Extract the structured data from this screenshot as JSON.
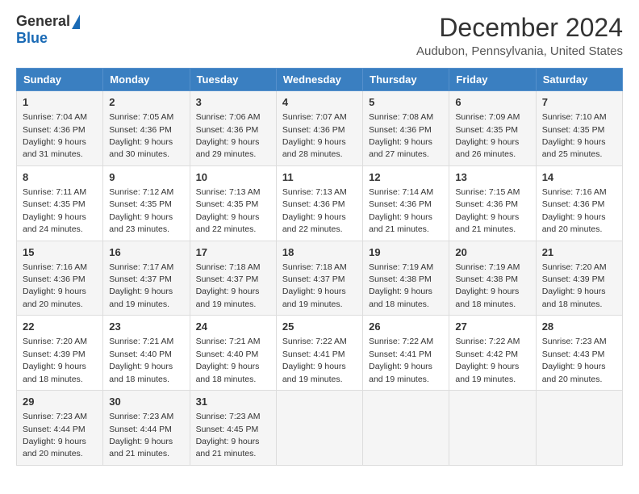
{
  "logo": {
    "general": "General",
    "blue": "Blue"
  },
  "title": "December 2024",
  "location": "Audubon, Pennsylvania, United States",
  "days_of_week": [
    "Sunday",
    "Monday",
    "Tuesday",
    "Wednesday",
    "Thursday",
    "Friday",
    "Saturday"
  ],
  "weeks": [
    [
      {
        "day": "1",
        "sunrise": "7:04 AM",
        "sunset": "4:36 PM",
        "daylight": "9 hours and 31 minutes."
      },
      {
        "day": "2",
        "sunrise": "7:05 AM",
        "sunset": "4:36 PM",
        "daylight": "9 hours and 30 minutes."
      },
      {
        "day": "3",
        "sunrise": "7:06 AM",
        "sunset": "4:36 PM",
        "daylight": "9 hours and 29 minutes."
      },
      {
        "day": "4",
        "sunrise": "7:07 AM",
        "sunset": "4:36 PM",
        "daylight": "9 hours and 28 minutes."
      },
      {
        "day": "5",
        "sunrise": "7:08 AM",
        "sunset": "4:36 PM",
        "daylight": "9 hours and 27 minutes."
      },
      {
        "day": "6",
        "sunrise": "7:09 AM",
        "sunset": "4:35 PM",
        "daylight": "9 hours and 26 minutes."
      },
      {
        "day": "7",
        "sunrise": "7:10 AM",
        "sunset": "4:35 PM",
        "daylight": "9 hours and 25 minutes."
      }
    ],
    [
      {
        "day": "8",
        "sunrise": "7:11 AM",
        "sunset": "4:35 PM",
        "daylight": "9 hours and 24 minutes."
      },
      {
        "day": "9",
        "sunrise": "7:12 AM",
        "sunset": "4:35 PM",
        "daylight": "9 hours and 23 minutes."
      },
      {
        "day": "10",
        "sunrise": "7:13 AM",
        "sunset": "4:35 PM",
        "daylight": "9 hours and 22 minutes."
      },
      {
        "day": "11",
        "sunrise": "7:13 AM",
        "sunset": "4:36 PM",
        "daylight": "9 hours and 22 minutes."
      },
      {
        "day": "12",
        "sunrise": "7:14 AM",
        "sunset": "4:36 PM",
        "daylight": "9 hours and 21 minutes."
      },
      {
        "day": "13",
        "sunrise": "7:15 AM",
        "sunset": "4:36 PM",
        "daylight": "9 hours and 21 minutes."
      },
      {
        "day": "14",
        "sunrise": "7:16 AM",
        "sunset": "4:36 PM",
        "daylight": "9 hours and 20 minutes."
      }
    ],
    [
      {
        "day": "15",
        "sunrise": "7:16 AM",
        "sunset": "4:36 PM",
        "daylight": "9 hours and 20 minutes."
      },
      {
        "day": "16",
        "sunrise": "7:17 AM",
        "sunset": "4:37 PM",
        "daylight": "9 hours and 19 minutes."
      },
      {
        "day": "17",
        "sunrise": "7:18 AM",
        "sunset": "4:37 PM",
        "daylight": "9 hours and 19 minutes."
      },
      {
        "day": "18",
        "sunrise": "7:18 AM",
        "sunset": "4:37 PM",
        "daylight": "9 hours and 19 minutes."
      },
      {
        "day": "19",
        "sunrise": "7:19 AM",
        "sunset": "4:38 PM",
        "daylight": "9 hours and 18 minutes."
      },
      {
        "day": "20",
        "sunrise": "7:19 AM",
        "sunset": "4:38 PM",
        "daylight": "9 hours and 18 minutes."
      },
      {
        "day": "21",
        "sunrise": "7:20 AM",
        "sunset": "4:39 PM",
        "daylight": "9 hours and 18 minutes."
      }
    ],
    [
      {
        "day": "22",
        "sunrise": "7:20 AM",
        "sunset": "4:39 PM",
        "daylight": "9 hours and 18 minutes."
      },
      {
        "day": "23",
        "sunrise": "7:21 AM",
        "sunset": "4:40 PM",
        "daylight": "9 hours and 18 minutes."
      },
      {
        "day": "24",
        "sunrise": "7:21 AM",
        "sunset": "4:40 PM",
        "daylight": "9 hours and 18 minutes."
      },
      {
        "day": "25",
        "sunrise": "7:22 AM",
        "sunset": "4:41 PM",
        "daylight": "9 hours and 19 minutes."
      },
      {
        "day": "26",
        "sunrise": "7:22 AM",
        "sunset": "4:41 PM",
        "daylight": "9 hours and 19 minutes."
      },
      {
        "day": "27",
        "sunrise": "7:22 AM",
        "sunset": "4:42 PM",
        "daylight": "9 hours and 19 minutes."
      },
      {
        "day": "28",
        "sunrise": "7:23 AM",
        "sunset": "4:43 PM",
        "daylight": "9 hours and 20 minutes."
      }
    ],
    [
      {
        "day": "29",
        "sunrise": "7:23 AM",
        "sunset": "4:44 PM",
        "daylight": "9 hours and 20 minutes."
      },
      {
        "day": "30",
        "sunrise": "7:23 AM",
        "sunset": "4:44 PM",
        "daylight": "9 hours and 21 minutes."
      },
      {
        "day": "31",
        "sunrise": "7:23 AM",
        "sunset": "4:45 PM",
        "daylight": "9 hours and 21 minutes."
      },
      null,
      null,
      null,
      null
    ]
  ]
}
